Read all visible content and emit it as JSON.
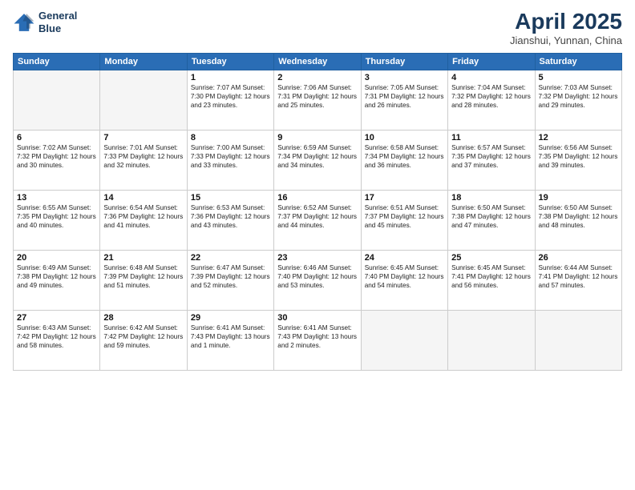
{
  "header": {
    "logo_line1": "General",
    "logo_line2": "Blue",
    "title": "April 2025",
    "subtitle": "Jianshui, Yunnan, China"
  },
  "calendar": {
    "weekdays": [
      "Sunday",
      "Monday",
      "Tuesday",
      "Wednesday",
      "Thursday",
      "Friday",
      "Saturday"
    ],
    "weeks": [
      [
        {
          "day": "",
          "info": ""
        },
        {
          "day": "",
          "info": ""
        },
        {
          "day": "1",
          "info": "Sunrise: 7:07 AM\nSunset: 7:30 PM\nDaylight: 12 hours\nand 23 minutes."
        },
        {
          "day": "2",
          "info": "Sunrise: 7:06 AM\nSunset: 7:31 PM\nDaylight: 12 hours\nand 25 minutes."
        },
        {
          "day": "3",
          "info": "Sunrise: 7:05 AM\nSunset: 7:31 PM\nDaylight: 12 hours\nand 26 minutes."
        },
        {
          "day": "4",
          "info": "Sunrise: 7:04 AM\nSunset: 7:32 PM\nDaylight: 12 hours\nand 28 minutes."
        },
        {
          "day": "5",
          "info": "Sunrise: 7:03 AM\nSunset: 7:32 PM\nDaylight: 12 hours\nand 29 minutes."
        }
      ],
      [
        {
          "day": "6",
          "info": "Sunrise: 7:02 AM\nSunset: 7:32 PM\nDaylight: 12 hours\nand 30 minutes."
        },
        {
          "day": "7",
          "info": "Sunrise: 7:01 AM\nSunset: 7:33 PM\nDaylight: 12 hours\nand 32 minutes."
        },
        {
          "day": "8",
          "info": "Sunrise: 7:00 AM\nSunset: 7:33 PM\nDaylight: 12 hours\nand 33 minutes."
        },
        {
          "day": "9",
          "info": "Sunrise: 6:59 AM\nSunset: 7:34 PM\nDaylight: 12 hours\nand 34 minutes."
        },
        {
          "day": "10",
          "info": "Sunrise: 6:58 AM\nSunset: 7:34 PM\nDaylight: 12 hours\nand 36 minutes."
        },
        {
          "day": "11",
          "info": "Sunrise: 6:57 AM\nSunset: 7:35 PM\nDaylight: 12 hours\nand 37 minutes."
        },
        {
          "day": "12",
          "info": "Sunrise: 6:56 AM\nSunset: 7:35 PM\nDaylight: 12 hours\nand 39 minutes."
        }
      ],
      [
        {
          "day": "13",
          "info": "Sunrise: 6:55 AM\nSunset: 7:35 PM\nDaylight: 12 hours\nand 40 minutes."
        },
        {
          "day": "14",
          "info": "Sunrise: 6:54 AM\nSunset: 7:36 PM\nDaylight: 12 hours\nand 41 minutes."
        },
        {
          "day": "15",
          "info": "Sunrise: 6:53 AM\nSunset: 7:36 PM\nDaylight: 12 hours\nand 43 minutes."
        },
        {
          "day": "16",
          "info": "Sunrise: 6:52 AM\nSunset: 7:37 PM\nDaylight: 12 hours\nand 44 minutes."
        },
        {
          "day": "17",
          "info": "Sunrise: 6:51 AM\nSunset: 7:37 PM\nDaylight: 12 hours\nand 45 minutes."
        },
        {
          "day": "18",
          "info": "Sunrise: 6:50 AM\nSunset: 7:38 PM\nDaylight: 12 hours\nand 47 minutes."
        },
        {
          "day": "19",
          "info": "Sunrise: 6:50 AM\nSunset: 7:38 PM\nDaylight: 12 hours\nand 48 minutes."
        }
      ],
      [
        {
          "day": "20",
          "info": "Sunrise: 6:49 AM\nSunset: 7:38 PM\nDaylight: 12 hours\nand 49 minutes."
        },
        {
          "day": "21",
          "info": "Sunrise: 6:48 AM\nSunset: 7:39 PM\nDaylight: 12 hours\nand 51 minutes."
        },
        {
          "day": "22",
          "info": "Sunrise: 6:47 AM\nSunset: 7:39 PM\nDaylight: 12 hours\nand 52 minutes."
        },
        {
          "day": "23",
          "info": "Sunrise: 6:46 AM\nSunset: 7:40 PM\nDaylight: 12 hours\nand 53 minutes."
        },
        {
          "day": "24",
          "info": "Sunrise: 6:45 AM\nSunset: 7:40 PM\nDaylight: 12 hours\nand 54 minutes."
        },
        {
          "day": "25",
          "info": "Sunrise: 6:45 AM\nSunset: 7:41 PM\nDaylight: 12 hours\nand 56 minutes."
        },
        {
          "day": "26",
          "info": "Sunrise: 6:44 AM\nSunset: 7:41 PM\nDaylight: 12 hours\nand 57 minutes."
        }
      ],
      [
        {
          "day": "27",
          "info": "Sunrise: 6:43 AM\nSunset: 7:42 PM\nDaylight: 12 hours\nand 58 minutes."
        },
        {
          "day": "28",
          "info": "Sunrise: 6:42 AM\nSunset: 7:42 PM\nDaylight: 12 hours\nand 59 minutes."
        },
        {
          "day": "29",
          "info": "Sunrise: 6:41 AM\nSunset: 7:43 PM\nDaylight: 13 hours\nand 1 minute."
        },
        {
          "day": "30",
          "info": "Sunrise: 6:41 AM\nSunset: 7:43 PM\nDaylight: 13 hours\nand 2 minutes."
        },
        {
          "day": "",
          "info": ""
        },
        {
          "day": "",
          "info": ""
        },
        {
          "day": "",
          "info": ""
        }
      ]
    ]
  }
}
